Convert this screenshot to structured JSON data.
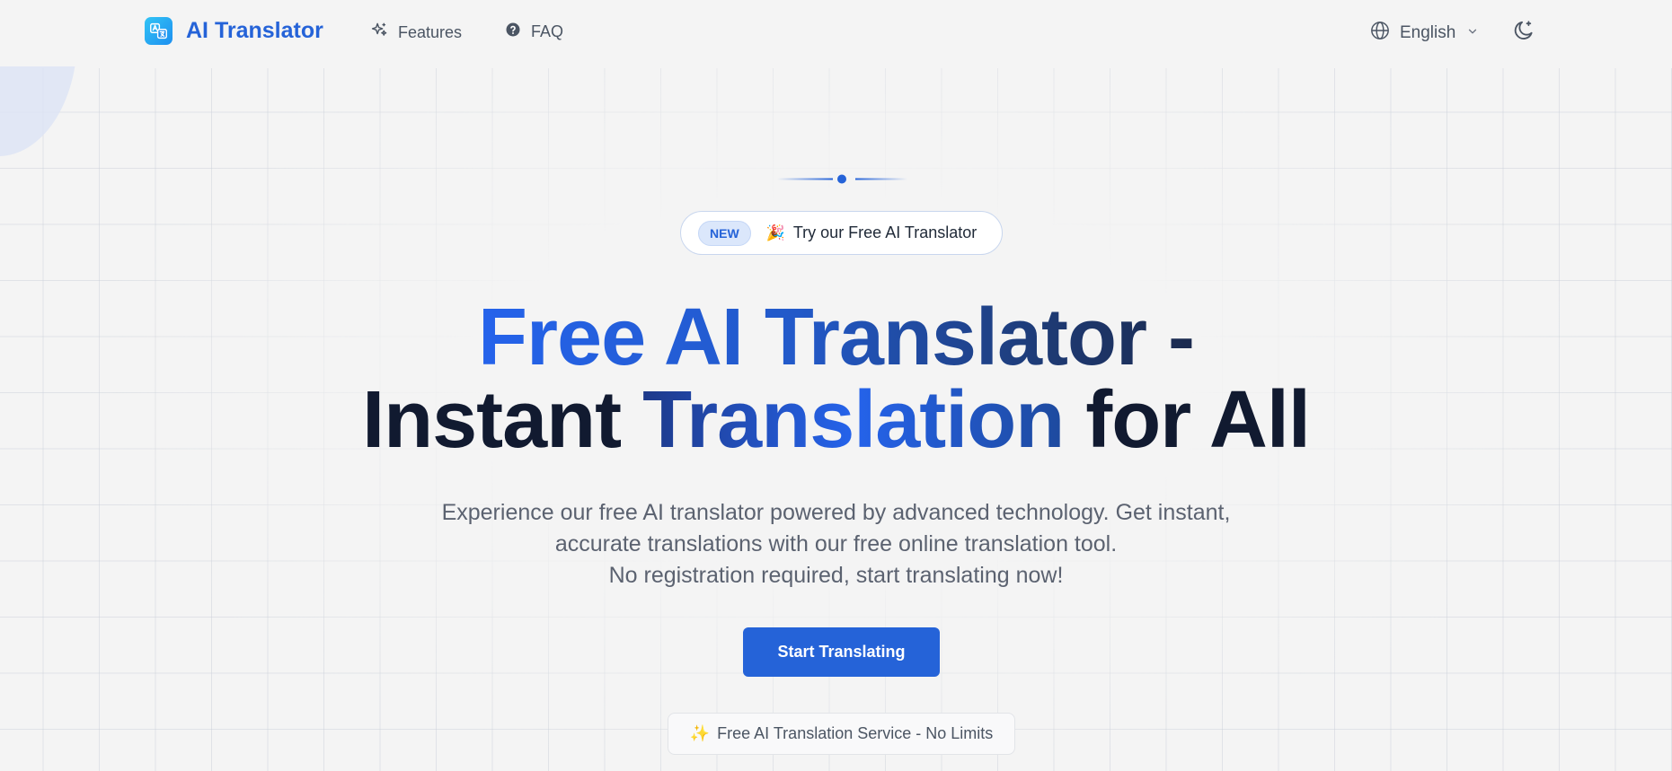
{
  "header": {
    "logo_text": "AI Translator",
    "logo_icon": "translate-icon",
    "nav": [
      {
        "label": "Features",
        "icon": "sparkles-icon"
      },
      {
        "label": "FAQ",
        "icon": "help-circle-icon"
      }
    ],
    "language": {
      "label": "English",
      "icon": "globe-icon"
    },
    "theme_toggle_icon": "moon-icon"
  },
  "hero": {
    "badge": {
      "tag": "NEW",
      "emoji": "🎉",
      "text": "Try our Free AI Translator"
    },
    "title_line1": "Free AI Translator -",
    "title_line2_part1": "Instant ",
    "title_line2_part2": "Translation",
    "title_line2_part3": " for All",
    "subtitle_lines": [
      "Experience our free AI translator powered by advanced technology. Get instant,",
      "accurate translations with our free online translation tool.",
      "No registration required, start translating now!"
    ],
    "cta_label": "Start Translating",
    "service_emoji": "✨",
    "service_text": "Free AI Translation Service - No Limits"
  },
  "colors": {
    "accent": "#2563d8",
    "background": "#f4f4f4",
    "title_dark": "#111a30",
    "text_muted": "#5b6270"
  }
}
